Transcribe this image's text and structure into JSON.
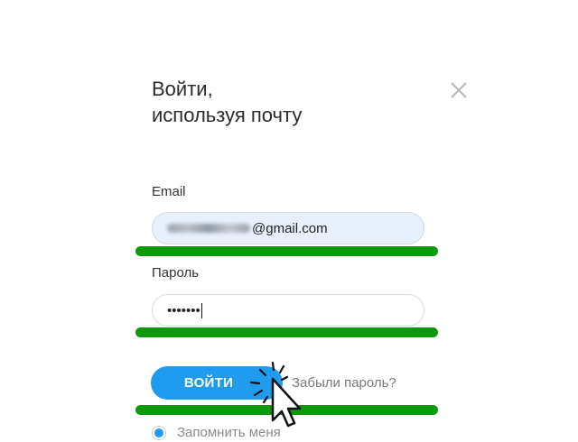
{
  "dialog": {
    "title_line1": "Войти,",
    "title_line2": "используя почту",
    "close_icon": "close-icon"
  },
  "form": {
    "email_label": "Email",
    "email_value_suffix": "@gmail.com",
    "password_label": "Пароль",
    "password_value": "•••••••",
    "login_button": "ВОЙТИ",
    "forgot_link": "Забыли пароль?",
    "remember_label": "Запомнить меня"
  },
  "colors": {
    "accent": "#1f9bf0",
    "highlight_bar": "#0c9a0c",
    "email_field_bg": "#e8f0fe"
  }
}
